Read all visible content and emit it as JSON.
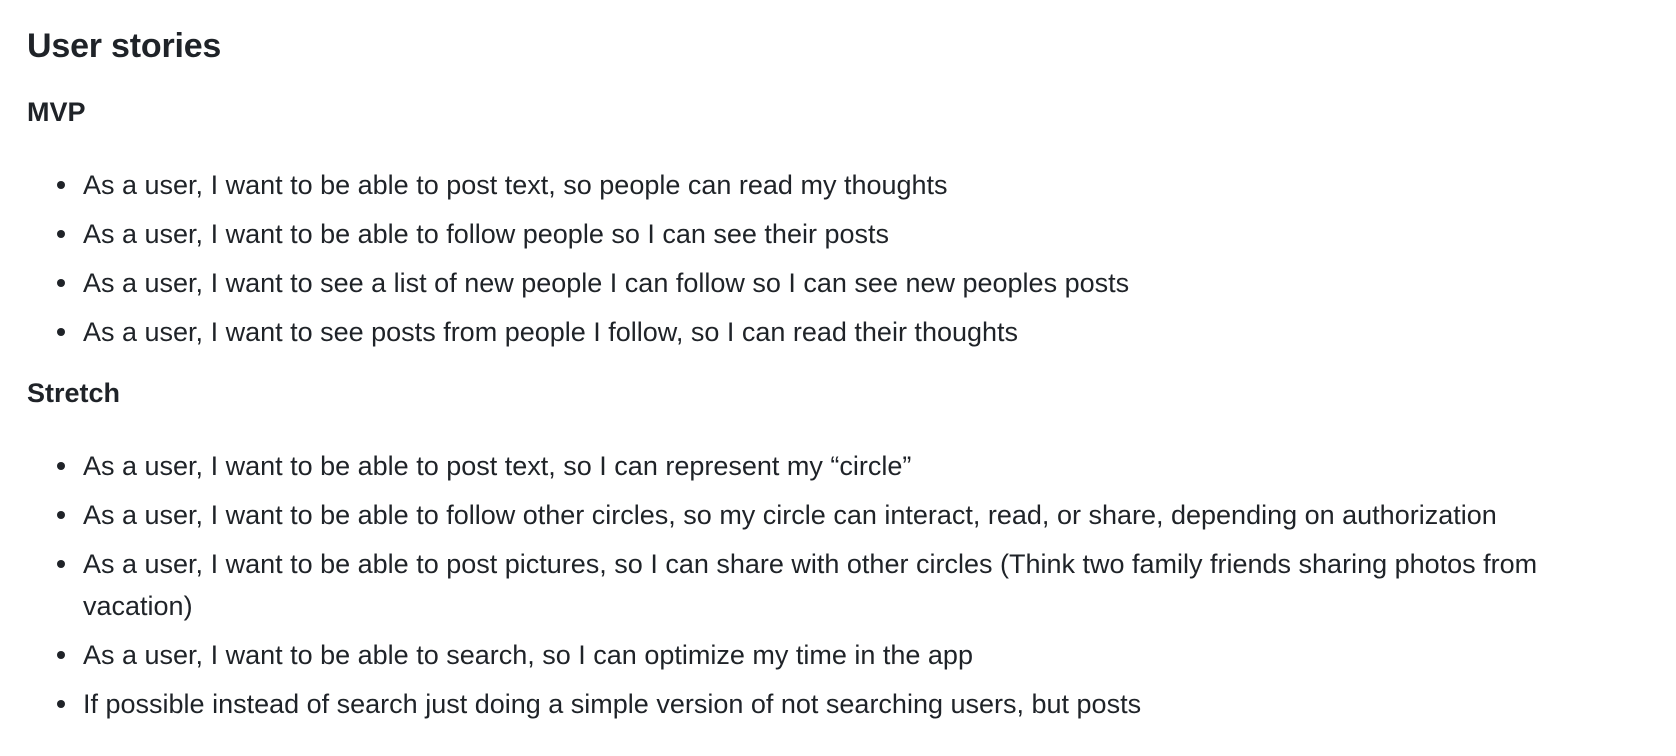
{
  "page": {
    "title": "User stories"
  },
  "sections": [
    {
      "heading": "MVP",
      "items": [
        "As a user, I want to be able to post text, so people can read my thoughts",
        "As a user, I want to be able to follow people so I can see their posts",
        "As a user, I want to see a list of new people I can follow so I can see new peoples posts",
        "As a user, I want to see posts from people I follow, so I can read their thoughts"
      ]
    },
    {
      "heading": "Stretch",
      "items": [
        "As a user, I want to be able to post text, so I can represent my “circle”",
        "As a user, I want to be able to follow other circles, so my circle can interact, read, or share, depending on authorization",
        "As a user, I want to be able to post pictures, so I can share with other circles (Think two family friends sharing photos from vacation)",
        "As a user, I want to be able to search, so I can optimize my time in the app",
        "If possible instead of search just doing a simple version of not searching users, but posts"
      ]
    }
  ]
}
